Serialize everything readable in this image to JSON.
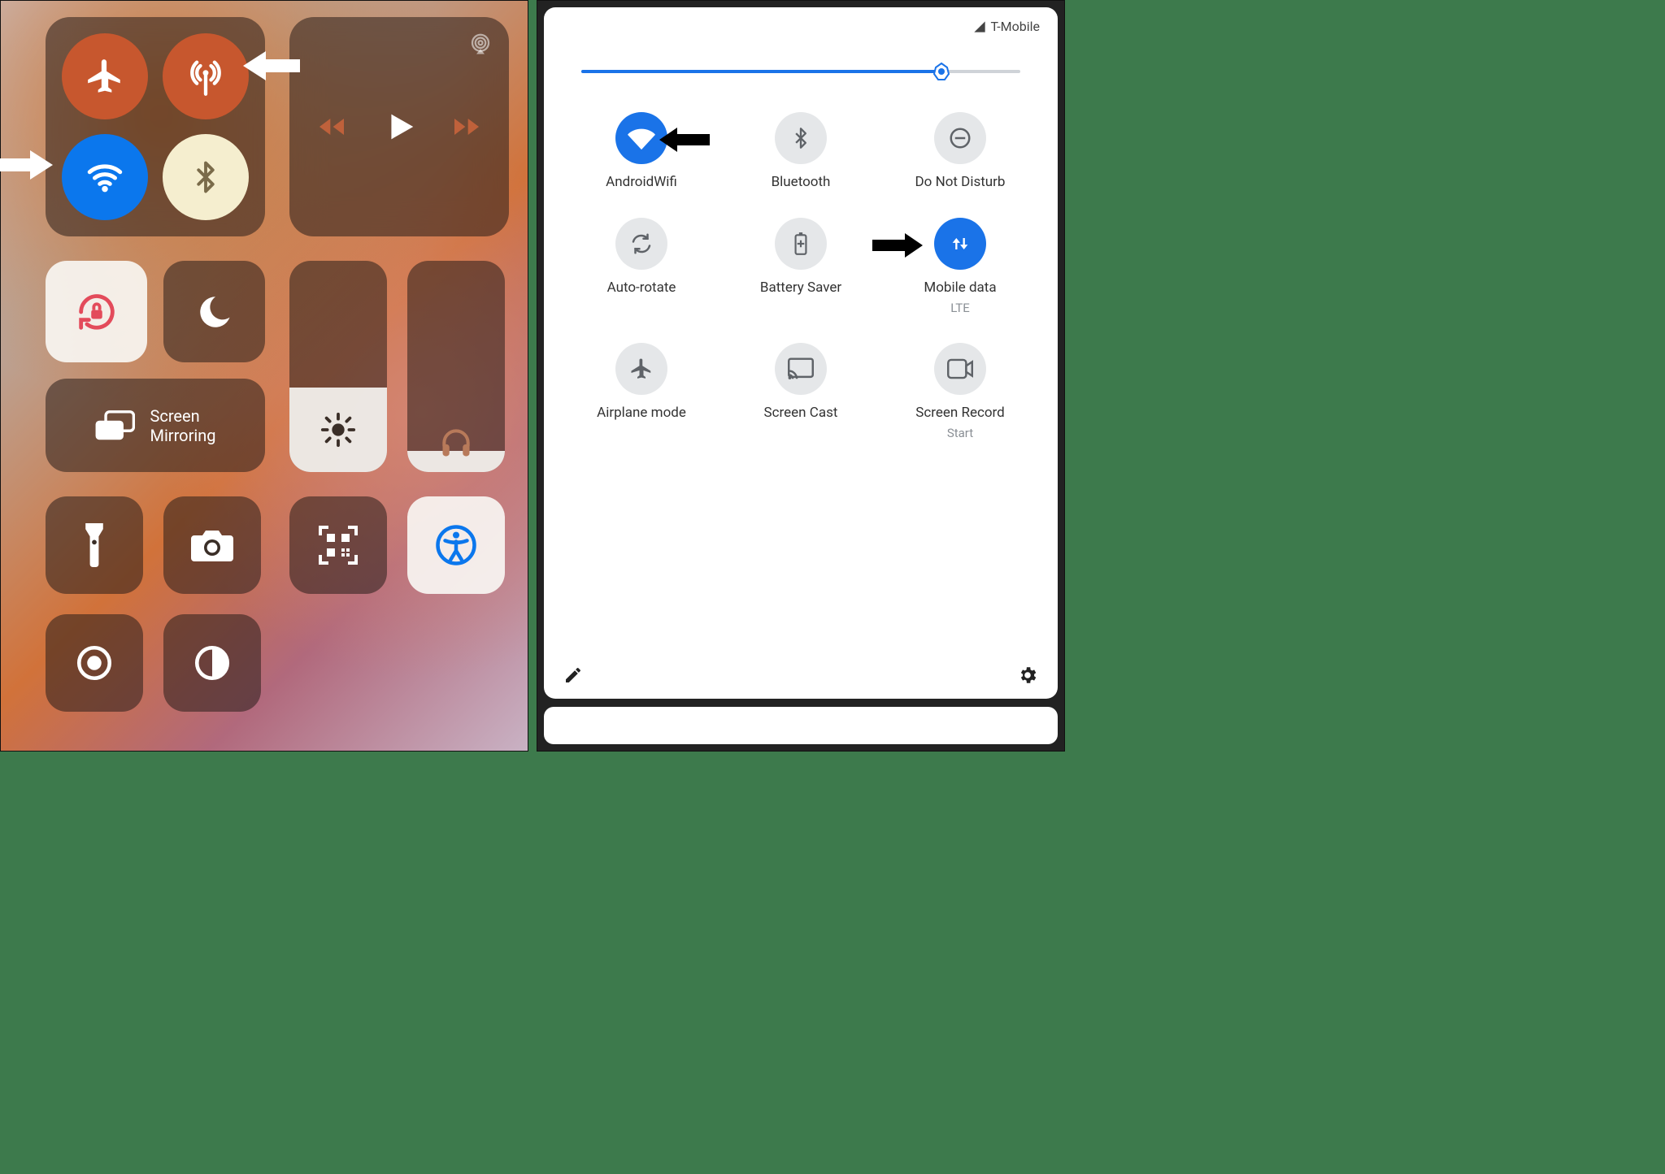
{
  "ios": {
    "screen_mirroring_label": "Screen\nMirroring",
    "brightness_percent": 40,
    "volume_percent": 10,
    "annotations": [
      {
        "target": "cellular-data-button"
      },
      {
        "target": "wifi-button"
      }
    ]
  },
  "android": {
    "carrier": "T-Mobile",
    "brightness_percent": 82,
    "tiles": [
      {
        "label": "AndroidWifi",
        "sub": "",
        "state": "on"
      },
      {
        "label": "Bluetooth",
        "sub": "",
        "state": "off"
      },
      {
        "label": "Do Not Disturb",
        "sub": "",
        "state": "off"
      },
      {
        "label": "Auto-rotate",
        "sub": "",
        "state": "off"
      },
      {
        "label": "Battery Saver",
        "sub": "",
        "state": "off"
      },
      {
        "label": "Mobile data",
        "sub": "LTE",
        "state": "on"
      },
      {
        "label": "Airplane mode",
        "sub": "",
        "state": "off"
      },
      {
        "label": "Screen Cast",
        "sub": "",
        "state": "off"
      },
      {
        "label": "Screen Record",
        "sub": "Start",
        "state": "off"
      }
    ],
    "annotations": [
      {
        "target": "qs-wifi"
      },
      {
        "target": "qs-mobile-data"
      }
    ]
  }
}
